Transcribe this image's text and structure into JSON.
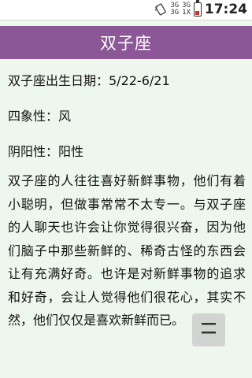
{
  "status_bar": {
    "rotate_icon": "rotate-icon",
    "sim1_top": "3G",
    "sim1_bottom": "3G",
    "sim2_top": "3G",
    "sim2_bottom": "1X",
    "battery_icon": "battery-icon",
    "time": "17:24"
  },
  "title_bar": {
    "title": "双子座"
  },
  "info": {
    "birth": "双子座出生日期：5/22-6/21",
    "element": "四象性：风",
    "polarity": "阴阳性：阳性"
  },
  "description": "双子座的人往往喜好新鲜事物，他们有着小聪明，但做事常常不太专一。与双子座的人聊天也许会让你觉得很兴奋，因为他们脑子中那些新鲜的、稀奇古怪的东西会让有充满好奇。也许是对新鲜事物的追求和好奇，会让人觉得他们很花心，其实不然，他们仅仅是喜欢新鲜而已。",
  "float_button": {
    "icon": "menu-icon"
  },
  "colors": {
    "title_bar": "#8b5796",
    "background": "#eef7ee",
    "text": "#111111"
  }
}
